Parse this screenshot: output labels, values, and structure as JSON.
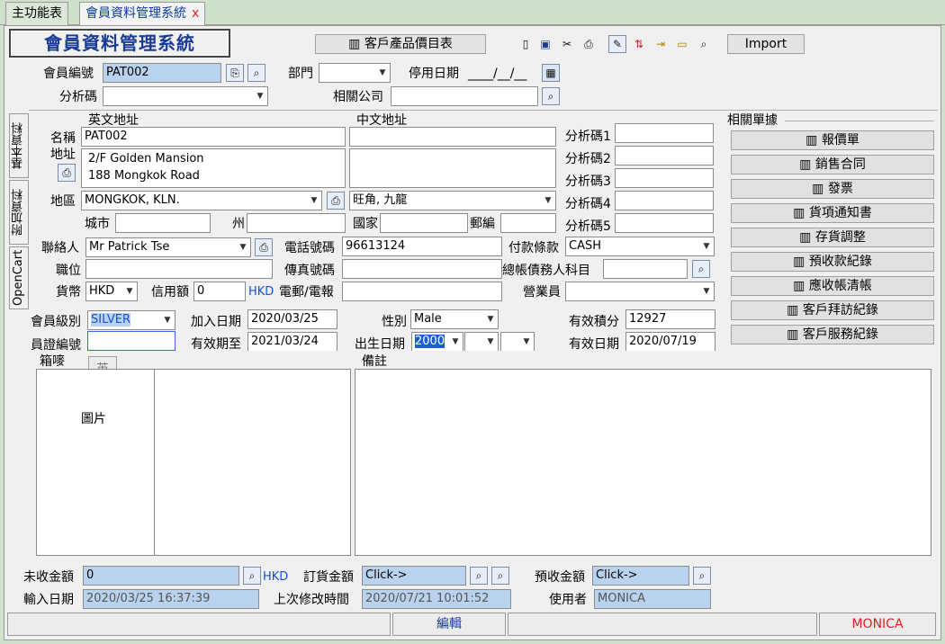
{
  "tabs": [
    {
      "label": "主功能表"
    },
    {
      "label": "會員資料管理系統",
      "close": "x"
    }
  ],
  "app_title": "會員資料管理系統",
  "toolbar": {
    "price_list": "客戶產品價目表",
    "import": "Import"
  },
  "header": {
    "member_no_label": "會員編號",
    "member_no": "PAT002",
    "dept_label": "部門",
    "dept": "",
    "stop_date_label": "停用日期",
    "stop_date": "____/__/__",
    "analysis_code_label": "分析碼",
    "analysis_code": "",
    "related_company_label": "相關公司",
    "related_company": ""
  },
  "side_tabs": [
    "基本資料",
    "附加資料",
    "OpenCart"
  ],
  "address": {
    "en_header": "英文地址",
    "cn_header": "中文地址",
    "name_label": "名稱",
    "name_en": "PAT002",
    "name_cn": "",
    "addr_label": "地址",
    "addr_line1": "2/F Golden Mansion",
    "addr_line2": "188 Mongkok Road",
    "district_label": "地區",
    "district_en": "MONGKOK, KLN.",
    "district_cn": "旺角, 九龍",
    "city_label": "城市",
    "city": "",
    "state_label": "州",
    "state": "",
    "country_label": "國家",
    "country": "",
    "postal_label": "郵編",
    "postal": ""
  },
  "analysis": [
    {
      "label": "分析碼1",
      "value": ""
    },
    {
      "label": "分析碼2",
      "value": ""
    },
    {
      "label": "分析碼3",
      "value": ""
    },
    {
      "label": "分析碼4",
      "value": ""
    },
    {
      "label": "分析碼5",
      "value": ""
    }
  ],
  "related_docs": {
    "header": "相關單據",
    "items": [
      "報價單",
      "銷售合同",
      "發票",
      "貨項通知書",
      "存貨調整",
      "預收款紀錄",
      "應收帳清帳",
      "客戶拜訪紀錄",
      "客戶服務紀錄"
    ]
  },
  "contact": {
    "contact_label": "聯絡人",
    "contact": "Mr Patrick Tse",
    "phone_label": "電話號碼",
    "phone": "96613124",
    "payment_label": "付款條款",
    "payment": "CASH",
    "position_label": "職位",
    "position": "",
    "fax_label": "傳真號碼",
    "fax": "",
    "ledger_label": "總帳債務人科目",
    "ledger": "",
    "currency_label": "貨幣",
    "currency": "HKD",
    "credit_label": "信用額",
    "credit": "0",
    "credit_cur": "HKD",
    "email_label": "電郵/電報",
    "email": "",
    "sales_label": "營業員",
    "sales": ""
  },
  "member": {
    "level_label": "會員級別",
    "level": "SILVER",
    "join_label": "加入日期",
    "join": "2020/03/25",
    "gender_label": "性別",
    "gender": "Male",
    "points_label": "有效積分",
    "points": "12927",
    "card_label": "員證編號",
    "card": "",
    "valid_label": "有效期至",
    "valid": "2021/03/24",
    "birth_label": "出生日期",
    "birth_year": "2000",
    "birth_m": "",
    "birth_d": "",
    "valid_date_label": "有效日期",
    "valid_date": "2020/07/19"
  },
  "box": {
    "label": "箱嘜",
    "lang": "英",
    "picture": "圖片"
  },
  "remark": {
    "label": "備註"
  },
  "footer": {
    "unreceived_label": "未收金額",
    "unreceived": "0",
    "unreceived_cur": "HKD",
    "order_label": "訂貨金額",
    "order": "Click->",
    "prepaid_label": "預收金額",
    "prepaid": "Click->",
    "input_date_label": "輸入日期",
    "input_date": "2020/03/25 16:37:39",
    "modified_label": "上次修改時間",
    "modified": "2020/07/21 10:01:52",
    "user_label": "使用者",
    "user": "MONICA"
  },
  "status": {
    "mode": "編輯",
    "user": "MONICA"
  },
  "colors": {
    "title": "#1a3c96",
    "highlight": "#b9d3ee",
    "user_red": "#e02020"
  }
}
